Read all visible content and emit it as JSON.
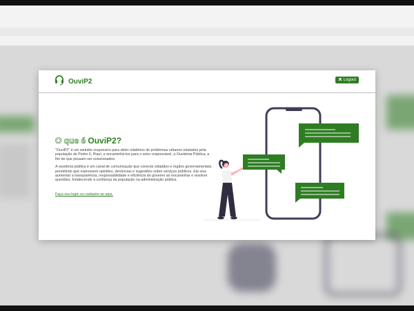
{
  "app": {
    "name": "OuviP2",
    "logout_label": "Logout"
  },
  "hero": {
    "title_prefix": "O que é",
    "title_brand": "OuviP2?",
    "paragraph_1": "\"OuviP2\" é um website responsivo para obter relatórios de problemas urbanos relatados pela população de Pedro II, Piauí, e encaminhá-los para o setor responsável, a Ouvidoria Pública, a fim de que possam ser solucionados.",
    "paragraph_2": "A ouvidoria pública é um canal de comunicação que conecta cidadãos e órgãos governamentais, permitindo que expressem opiniões, denúncias e sugestões sobre serviços públicos. Ela visa aumentar a transparência, responsabilidade e eficiência do governo ao encaminhar e resolver questões, fortalecendo a confiança da população na administração pública.",
    "cta_link": "Faça seu login ou cadastre-se aqui."
  },
  "colors": {
    "brand_green": "#2e7d22",
    "dark_gray": "#3f3d56"
  },
  "icons": {
    "logo": "headset-icon",
    "logout": "close-x-icon"
  }
}
